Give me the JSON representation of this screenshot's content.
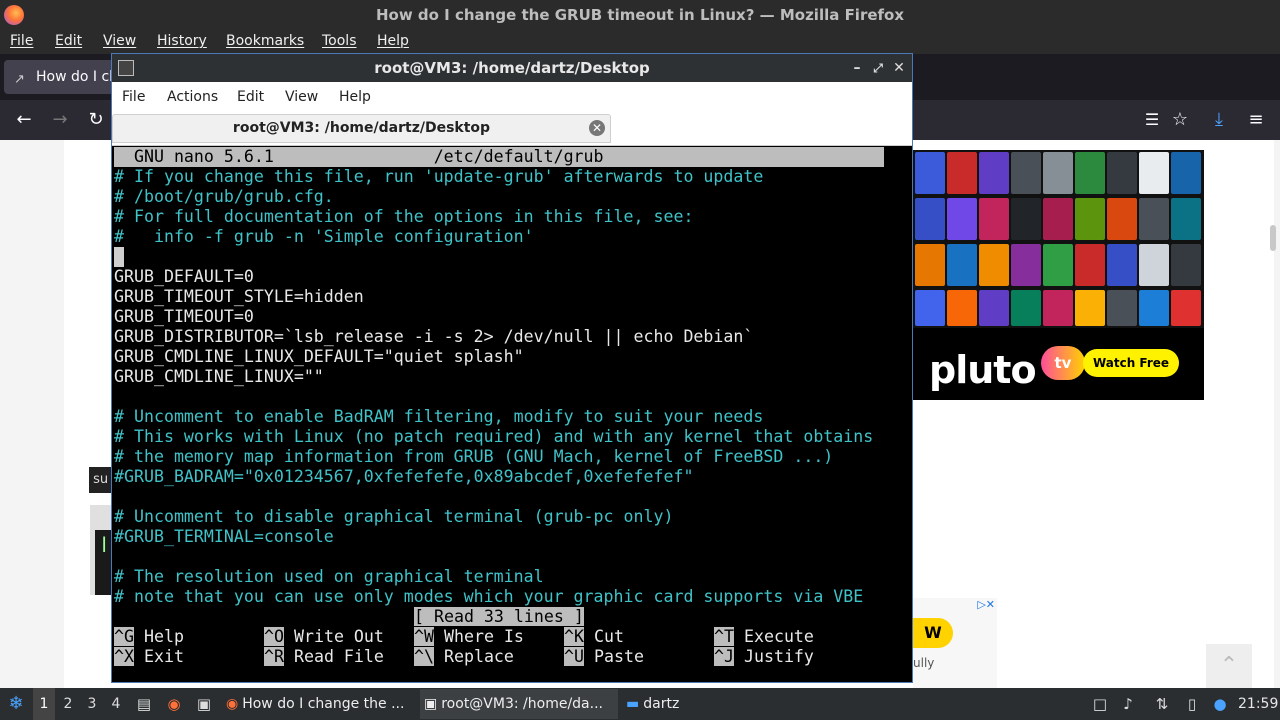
{
  "firefox": {
    "window_title": "How do I change the GRUB timeout in Linux? — Mozilla Firefox",
    "menu": [
      "File",
      "Edit",
      "View",
      "History",
      "Bookmarks",
      "Tools",
      "Help"
    ],
    "tab_title": "How do I change the GRUB timeout in Linux?",
    "tab_visible_text": "How do I ch"
  },
  "page": {
    "ad_logo_text": "pluto",
    "ad_tv_text": "tv",
    "ad_button": "Watch Free",
    "code_label_partial": "su",
    "code_char": "l",
    "ad2_button_partial": "W",
    "ad2_text_partial": "ully"
  },
  "terminal": {
    "window_title": "root@VM3: /home/dartz/Desktop",
    "menu": [
      "File",
      "Actions",
      "Edit",
      "View",
      "Help"
    ],
    "tab_title": "root@VM3: /home/dartz/Desktop",
    "nano_header": "  GNU nano 5.6.1                /etc/default/grub",
    "lines": [
      {
        "text": "# If you change this file, run 'update-grub' afterwards to update",
        "comment": true
      },
      {
        "text": "# /boot/grub/grub.cfg.",
        "comment": true
      },
      {
        "text": "# For full documentation of the options in this file, see:",
        "comment": true
      },
      {
        "text": "#   info -f grub -n 'Simple configuration'",
        "comment": true
      },
      {
        "text": "",
        "comment": false
      },
      {
        "text": "GRUB_DEFAULT=0",
        "comment": false
      },
      {
        "text": "GRUB_TIMEOUT_STYLE=hidden",
        "comment": false
      },
      {
        "text": "GRUB_TIMEOUT=0",
        "comment": false
      },
      {
        "text": "GRUB_DISTRIBUTOR=`lsb_release -i -s 2> /dev/null || echo Debian`",
        "comment": false
      },
      {
        "text": "GRUB_CMDLINE_LINUX_DEFAULT=\"quiet splash\"",
        "comment": false
      },
      {
        "text": "GRUB_CMDLINE_LINUX=\"\"",
        "comment": false
      },
      {
        "text": "",
        "comment": false
      },
      {
        "text": "# Uncomment to enable BadRAM filtering, modify to suit your needs",
        "comment": true
      },
      {
        "text": "# This works with Linux (no patch required) and with any kernel that obtains",
        "comment": true
      },
      {
        "text": "# the memory map information from GRUB (GNU Mach, kernel of FreeBSD ...)",
        "comment": true
      },
      {
        "text": "#GRUB_BADRAM=\"0x01234567,0xfefefefe,0x89abcdef,0xefefefef\"",
        "comment": true
      },
      {
        "text": "",
        "comment": false
      },
      {
        "text": "# Uncomment to disable graphical terminal (grub-pc only)",
        "comment": true
      },
      {
        "text": "#GRUB_TERMINAL=console",
        "comment": true
      },
      {
        "text": "",
        "comment": false
      },
      {
        "text": "# The resolution used on graphical terminal",
        "comment": true
      },
      {
        "text": "# note that you can use only modes which your graphic card supports via VBE",
        "comment": true
      }
    ],
    "status": "[ Read 33 lines ]",
    "shortcuts_row1": [
      {
        "key": "^G",
        "label": "Help"
      },
      {
        "key": "^O",
        "label": "Write Out"
      },
      {
        "key": "^W",
        "label": "Where Is"
      },
      {
        "key": "^K",
        "label": "Cut"
      },
      {
        "key": "^T",
        "label": "Execute"
      }
    ],
    "shortcuts_row2": [
      {
        "key": "^X",
        "label": "Exit"
      },
      {
        "key": "^R",
        "label": "Read File"
      },
      {
        "key": "^\\",
        "label": "Replace"
      },
      {
        "key": "^U",
        "label": "Paste"
      },
      {
        "key": "^J",
        "label": "Justify"
      }
    ]
  },
  "taskbar": {
    "workspaces": [
      "1",
      "2",
      "3",
      "4"
    ],
    "tasks": [
      {
        "label": "How do I change the ...",
        "icon": "firefox-icon"
      },
      {
        "label": "root@VM3: /home/da...",
        "icon": "terminal-icon"
      },
      {
        "label": "dartz",
        "icon": "folder-icon"
      }
    ],
    "clock": "21:59"
  },
  "colors": {
    "nano_comment": "#3fc2c8",
    "nano_header_bg": "#bdbdbd",
    "firefox_chrome": "#2b2a33",
    "taskbar": "#2b2e31",
    "pluto_watch": "#fff200"
  }
}
